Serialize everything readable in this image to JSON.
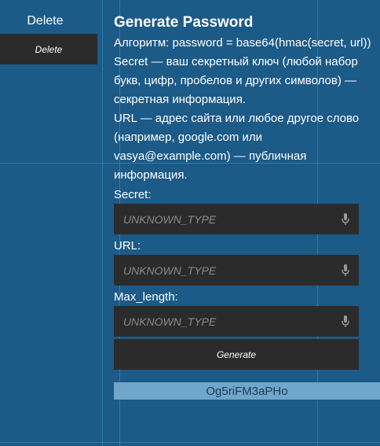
{
  "sidebar": {
    "title": "Delete",
    "button_label": "Delete"
  },
  "main": {
    "heading": "Generate Password",
    "description": [
      "Алгоритм: password = base64(hmac(secret, url))",
      "Secret — ваш секретный ключ (любой набор букв, цифр, пробелов и других символов) — секретная информация.",
      "URL — адрес сайта или любое другое слово (например, google.com или vasya@example.com) — публичная информация."
    ],
    "fields": [
      {
        "label": "Secret:",
        "placeholder": "UNKNOWN_TYPE",
        "value": ""
      },
      {
        "label": "URL:",
        "placeholder": "UNKNOWN_TYPE",
        "value": ""
      },
      {
        "label": "Max_length:",
        "placeholder": "UNKNOWN_TYPE",
        "value": ""
      }
    ],
    "generate_label": "Generate",
    "result": "Og5riFM3aPHo"
  },
  "icons": {
    "field_icon": "microphone-icon"
  },
  "colors": {
    "background": "#1c5a87",
    "panel": "#2b2b2b",
    "result_bg": "#6fa6c9",
    "guide": "#2f7fb0"
  }
}
